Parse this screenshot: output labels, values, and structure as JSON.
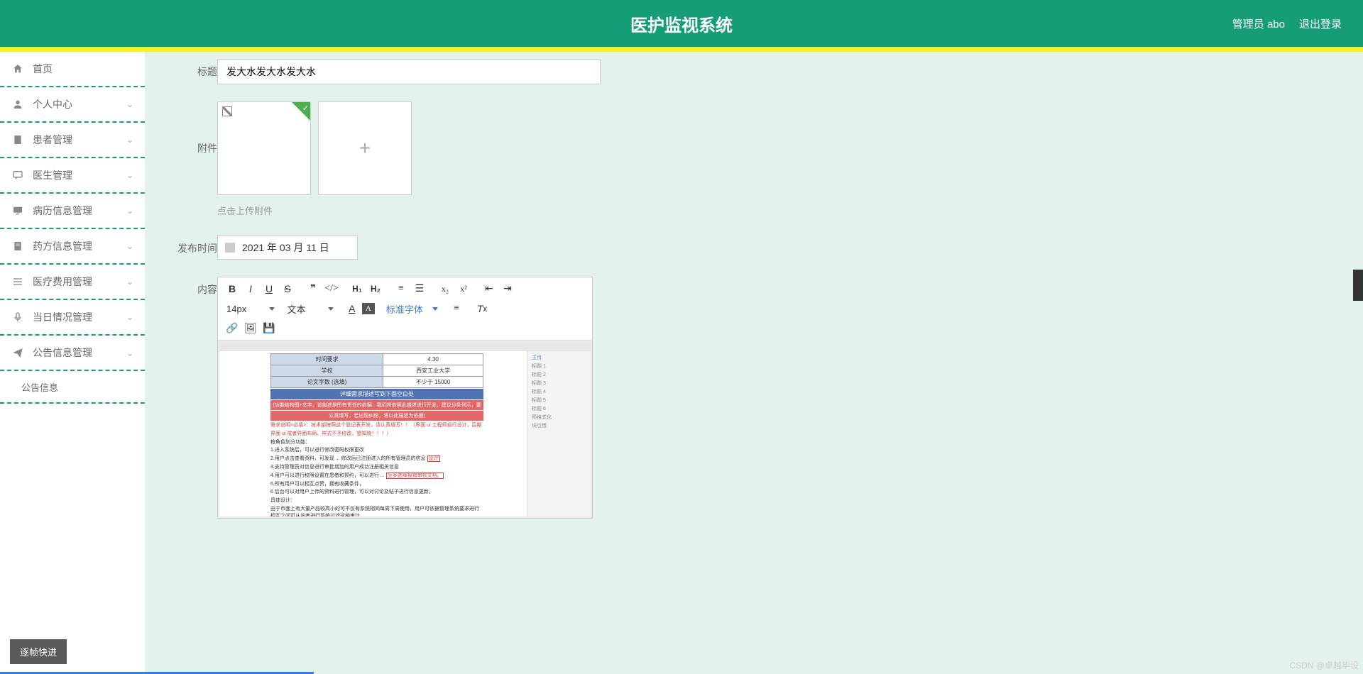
{
  "header": {
    "title": "医护监视系统",
    "admin": "管理员 abo",
    "logout": "退出登录"
  },
  "sidebar": {
    "items": [
      {
        "icon": "home",
        "label": "首页",
        "chevron": false
      },
      {
        "icon": "person",
        "label": "个人中心",
        "chevron": true
      },
      {
        "icon": "clipboard",
        "label": "患者管理",
        "chevron": true
      },
      {
        "icon": "chat",
        "label": "医生管理",
        "chevron": true
      },
      {
        "icon": "monitor",
        "label": "病历信息管理",
        "chevron": true
      },
      {
        "icon": "file",
        "label": "药方信息管理",
        "chevron": true
      },
      {
        "icon": "list",
        "label": "医疗费用管理",
        "chevron": true
      },
      {
        "icon": "mic",
        "label": "当日情况管理",
        "chevron": true
      },
      {
        "icon": "send",
        "label": "公告信息管理",
        "chevron": true,
        "expanded": true
      }
    ],
    "subitem": "公告信息"
  },
  "form": {
    "title_label": "标题",
    "title_value": "发大水发大水发大水",
    "attach_label": "附件",
    "attach_hint": "点击上传附件",
    "date_label": "发布时间",
    "date_value": "2021 年 03 月 11 日",
    "content_label": "内容"
  },
  "editor": {
    "font_size": "14px",
    "text_style": "文本",
    "font_family": "标准字体",
    "doc_table": {
      "r1k": "时间要求",
      "r1v": "4.30",
      "r2k": "学校",
      "r2v": "西安工业大学",
      "r3k": "论文字数 (选填)",
      "r3v": "不少于 15000"
    },
    "bar_blue": "详细需求描述写到下面空白处",
    "bar_red1": "(功能结构图+文字，该描述是所有责任的依据，我们将依照此描述进行开发，建议分条列示，要",
    "bar_red2": "认真填写，若出现纠纷，将以此描述为依据)",
    "doc_line_red": "需求说明<必填>：技术部按照这个登记表开发，请认真填写！！（界面 ui 工程师自行设计，后期",
    "doc_line_red2": "界面 ui 或者界面布局、样式不予修改，望知晓！！！）",
    "doc_heading": "按角色划分功能：",
    "doc_b1": "1.进入系统后，可以进行修改密码权限更改",
    "doc_b2": "2.用户点击查看资料，可发现 ... 修改后已注册进入的所有管理员的信息",
    "doc_b3": "3.支持管理员对信息进行审批增加的用户成功注册相关信息",
    "doc_b4": "4.用户可以进行权限设置在患者和预约，可以进行 ...",
    "doc_b5": "5.所有用户可以相互点赞，拥有收藏条件，",
    "doc_b6": "6.后台可以对用户上传的资料进行管理，可以对讨论及帖子进行信息更新。",
    "doc_heading2": "具体设计：",
    "doc_p2": "由于市面上有大量产品较高小的可不仅有系统相同每周下周使用，用户可依据管理系统要求进行相互之间可从该者进行系统过滤这种审计",
    "side_items": [
      "主页",
      "标题 1",
      "标题 2",
      "标题 3",
      "标题 4",
      "标题 5",
      "标题 6",
      "预格式化",
      "块引用"
    ]
  },
  "bottom_button": "逐帧快进",
  "watermark": "CSDN @卓越毕设"
}
